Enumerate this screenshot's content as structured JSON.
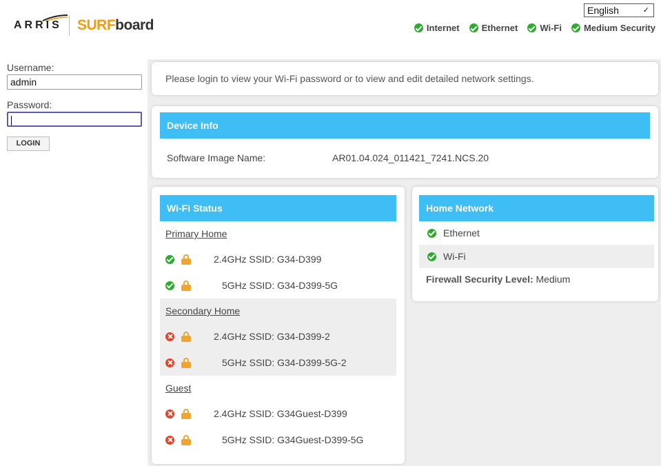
{
  "brand": {
    "arris": "ARRIS",
    "surf": "SURF",
    "board": "board"
  },
  "language": {
    "selected": "English"
  },
  "status_bar": [
    {
      "label": "Internet",
      "icon": "check-circle-icon"
    },
    {
      "label": "Ethernet",
      "icon": "check-circle-icon"
    },
    {
      "label": "Wi-Fi",
      "icon": "check-circle-icon"
    },
    {
      "label": "Medium Security",
      "icon": "check-circle-icon"
    }
  ],
  "login": {
    "username_label": "Username:",
    "username_value": "admin",
    "password_label": "Password:",
    "password_value": "",
    "login_button": "LOGIN"
  },
  "login_message": "Please login to view your Wi-Fi password or to view and edit detailed network settings.",
  "device_info": {
    "title": "Device Info",
    "software_label": "Software Image Name:",
    "software_value": "AR01.04.024_011421_7241.NCS.20"
  },
  "wifi_status": {
    "title": "Wi-Fi Status",
    "sections": [
      {
        "name": "Primary Home",
        "rows": [
          {
            "label": "2.4GHz SSID: G34-D399",
            "status": "ok"
          },
          {
            "label": "5GHz SSID: G34-D399-5G",
            "status": "ok"
          }
        ]
      },
      {
        "name": "Secondary Home",
        "rows": [
          {
            "label": "2.4GHz SSID: G34-D399-2",
            "status": "off"
          },
          {
            "label": "5GHz SSID: G34-D399-5G-2",
            "status": "off"
          }
        ]
      },
      {
        "name": "Guest",
        "rows": [
          {
            "label": "2.4GHz SSID: G34Guest-D399",
            "status": "off"
          },
          {
            "label": "5GHz SSID: G34Guest-D399-5G",
            "status": "off"
          }
        ]
      }
    ]
  },
  "home_network": {
    "title": "Home Network",
    "items": [
      {
        "label": "Ethernet",
        "status": "ok"
      },
      {
        "label": "Wi-Fi",
        "status": "ok"
      }
    ],
    "firewall_label": "Firewall Security Level:",
    "firewall_value": "Medium"
  },
  "colors": {
    "accent": "#3fbef5",
    "ok": "#2eaa2e",
    "error": "#e0452e",
    "lock": "#f0a530",
    "brand_orange": "#f39c12"
  }
}
